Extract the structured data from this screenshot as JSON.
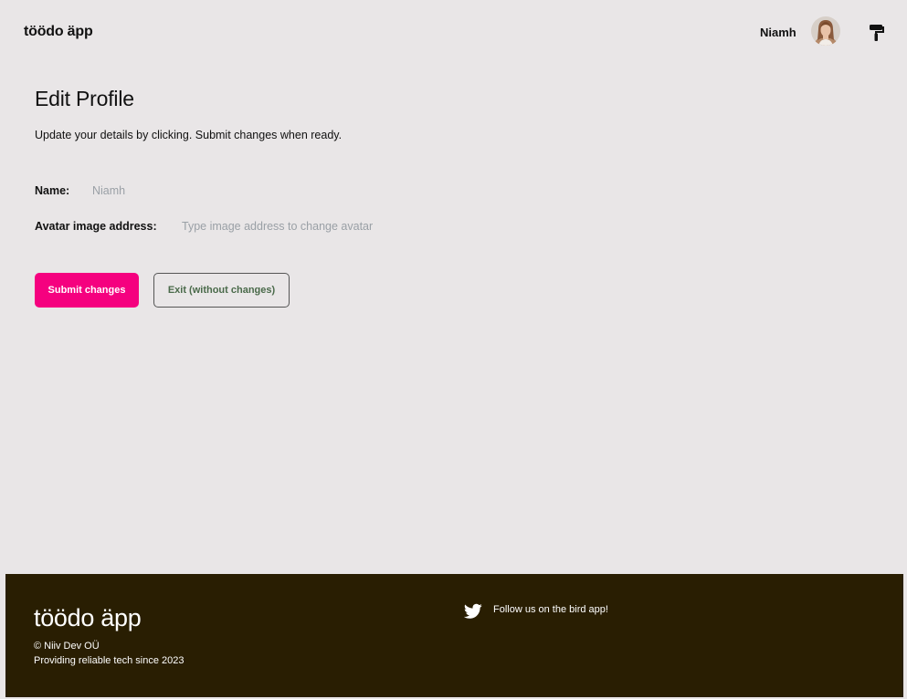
{
  "header": {
    "brand": "töödo äpp",
    "user_name": "Niamh"
  },
  "main": {
    "title": "Edit Profile",
    "subtitle": "Update your details by clicking. Submit changes when ready.",
    "name_label": "Name:",
    "name_placeholder": "Niamh",
    "avatar_label": "Avatar image address:",
    "avatar_placeholder": "Type image address to change avatar",
    "submit_label": "Submit changes",
    "exit_label": "Exit (without changes)"
  },
  "footer": {
    "brand": "töödo äpp",
    "copyright": "© Niiv Dev OÜ",
    "tagline": "Providing reliable tech since 2023",
    "twitter_text": "Follow us on the bird app!"
  },
  "colors": {
    "background": "#e9e6e7",
    "accent": "#f5017f",
    "footer_bg": "#291e02"
  }
}
